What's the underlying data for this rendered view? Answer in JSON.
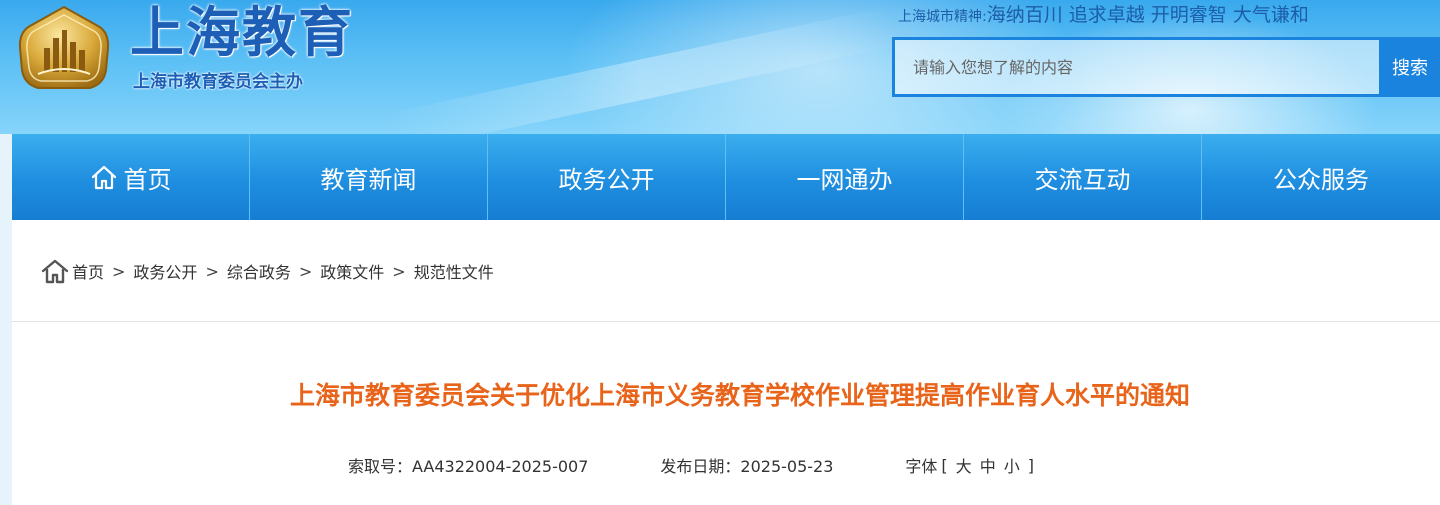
{
  "header": {
    "site_title": "上海教育",
    "site_subtitle": "上海市教育委员会主办",
    "slogan_label": "上海城市精神:",
    "slogan_text": "海纳百川 追求卓越 开明睿智 大气谦和",
    "search": {
      "placeholder": "请输入您想了解的内容",
      "button_label": "搜索"
    }
  },
  "nav": {
    "items": [
      {
        "label": "首页",
        "icon": "home-icon"
      },
      {
        "label": "教育新闻"
      },
      {
        "label": "政务公开"
      },
      {
        "label": "一网通办"
      },
      {
        "label": "交流互动"
      },
      {
        "label": "公众服务"
      }
    ]
  },
  "breadcrumb": {
    "items": [
      "首页",
      "政务公开",
      "综合政务",
      "政策文件",
      "规范性文件"
    ],
    "separator": ">"
  },
  "article": {
    "title": "上海市教育委员会关于优化上海市义务教育学校作业管理提高作业育人水平的通知",
    "index_no": "索取号：AA4322004-2025-007",
    "publish_date": "发布日期：2025-05-23",
    "font_size_label": "字体",
    "font_size_open": "[",
    "font_size_large": "大",
    "font_size_medium": "中",
    "font_size_small": "小",
    "font_size_close": "]"
  },
  "colors": {
    "nav_blue": "#1f8ee0",
    "title_orange": "#e8641a",
    "brand_blue": "#1d5fb6"
  }
}
